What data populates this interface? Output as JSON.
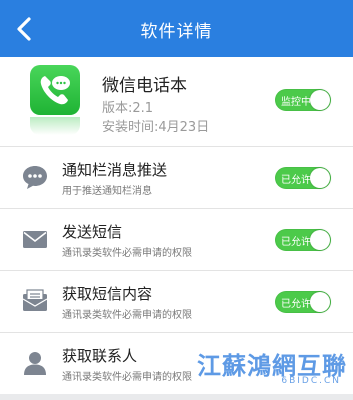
{
  "header": {
    "title": "软件详情",
    "back_icon": "chevron-left-icon",
    "bg_color": "#2a7fe0"
  },
  "app": {
    "icon": "phone-chat-icon",
    "name": "微信电话本",
    "version": "版本:2.1",
    "install_time": "安装时间:4月23日",
    "status_toggle": {
      "label": "监控中",
      "on": true
    }
  },
  "permissions": [
    {
      "icon": "chat-bubble-icon",
      "title": "通知栏消息推送",
      "desc": "用于推送通知栏消息",
      "toggle_label": "已允许",
      "on": true
    },
    {
      "icon": "envelope-icon",
      "title": "发送短信",
      "desc": "通讯录类软件必需申请的权限",
      "toggle_label": "已允许",
      "on": true
    },
    {
      "icon": "open-envelope-icon",
      "title": "获取短信内容",
      "desc": "通讯录类软件必需申请的权限",
      "toggle_label": "已允许",
      "on": true
    },
    {
      "icon": "person-icon",
      "title": "获取联系人",
      "desc": "通讯录类软件必需申请的权限",
      "toggle_label": "已允许",
      "on": true
    }
  ],
  "watermark": {
    "text": "江蘇鴻網互聯",
    "sub": "6BIDC.CN"
  },
  "colors": {
    "toggle_on": "#4cca4a",
    "icon_gray": "#7d8591"
  }
}
